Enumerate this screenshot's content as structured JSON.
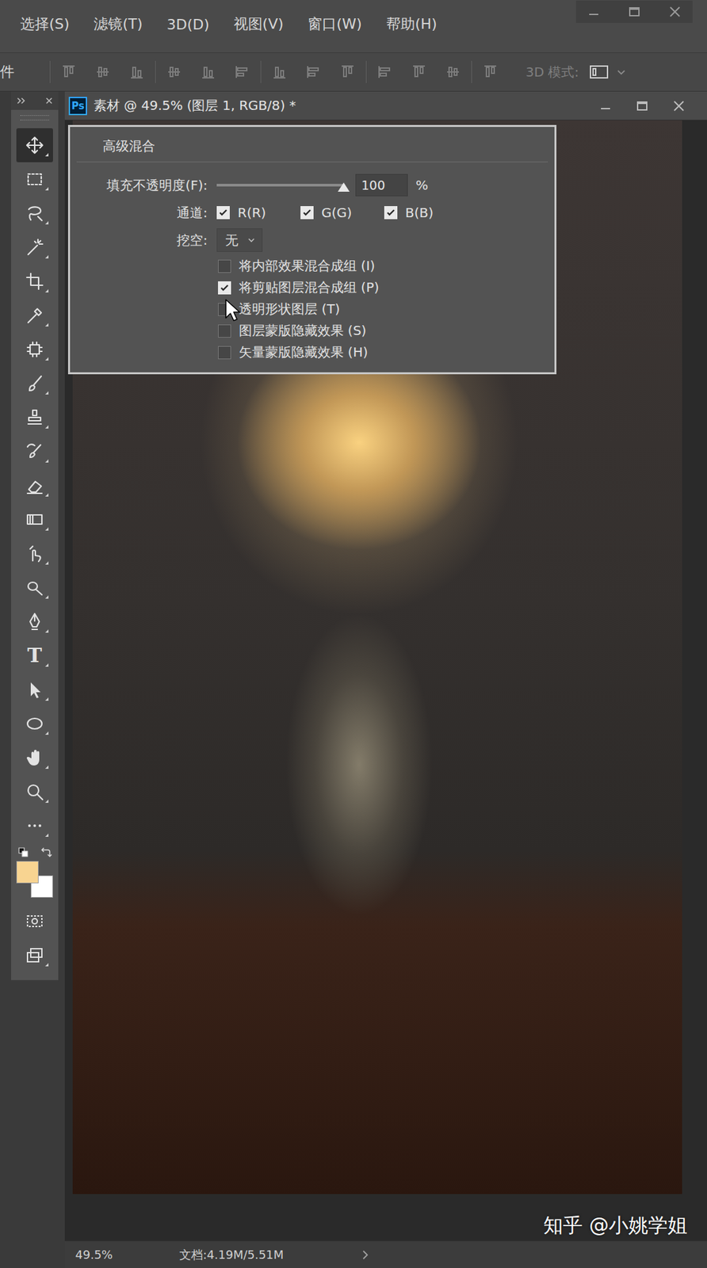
{
  "menu": [
    "选择(S)",
    "滤镜(T)",
    "3D(D)",
    "视图(V)",
    "窗口(W)",
    "帮助(H)"
  ],
  "options_bar": {
    "cut_label": "件",
    "mode_label": "3D 模式:"
  },
  "document": {
    "app_badge": "Ps",
    "title": "素材 @ 49.5% (图层 1, RGB/8) *"
  },
  "toolbox": {
    "type_tool_glyph": "T",
    "swatches": [
      {
        "name": "foreground",
        "color": "#f8d491"
      },
      {
        "name": "background",
        "color": "#ffffff"
      }
    ]
  },
  "blend_panel": {
    "title": "高级混合",
    "fill_opacity": {
      "label": "填充不透明度(F):",
      "level": 1,
      "value": "100",
      "unit": "%"
    },
    "channels_label": "通道:",
    "channels": [
      {
        "label": "R(R)",
        "checked": true
      },
      {
        "label": "G(G)",
        "checked": true
      },
      {
        "label": "B(B)",
        "checked": true
      }
    ],
    "knockout": {
      "label": "挖空:",
      "value": "无"
    },
    "options": [
      {
        "label": "将内部效果混合成组 (I)",
        "checked": false
      },
      {
        "label": "将剪贴图层混合成组 (P)",
        "checked": true
      },
      {
        "label": "透明形状图层 (T)",
        "checked": false
      },
      {
        "label": "图层蒙版隐藏效果 (S)",
        "checked": false
      },
      {
        "label": "矢量蒙版隐藏效果 (H)",
        "checked": false
      }
    ]
  },
  "status_bar": {
    "zoom": "49.5%",
    "doc_info": "文档:4.19M/5.51M"
  },
  "watermark": "知乎 @小姚学姐"
}
